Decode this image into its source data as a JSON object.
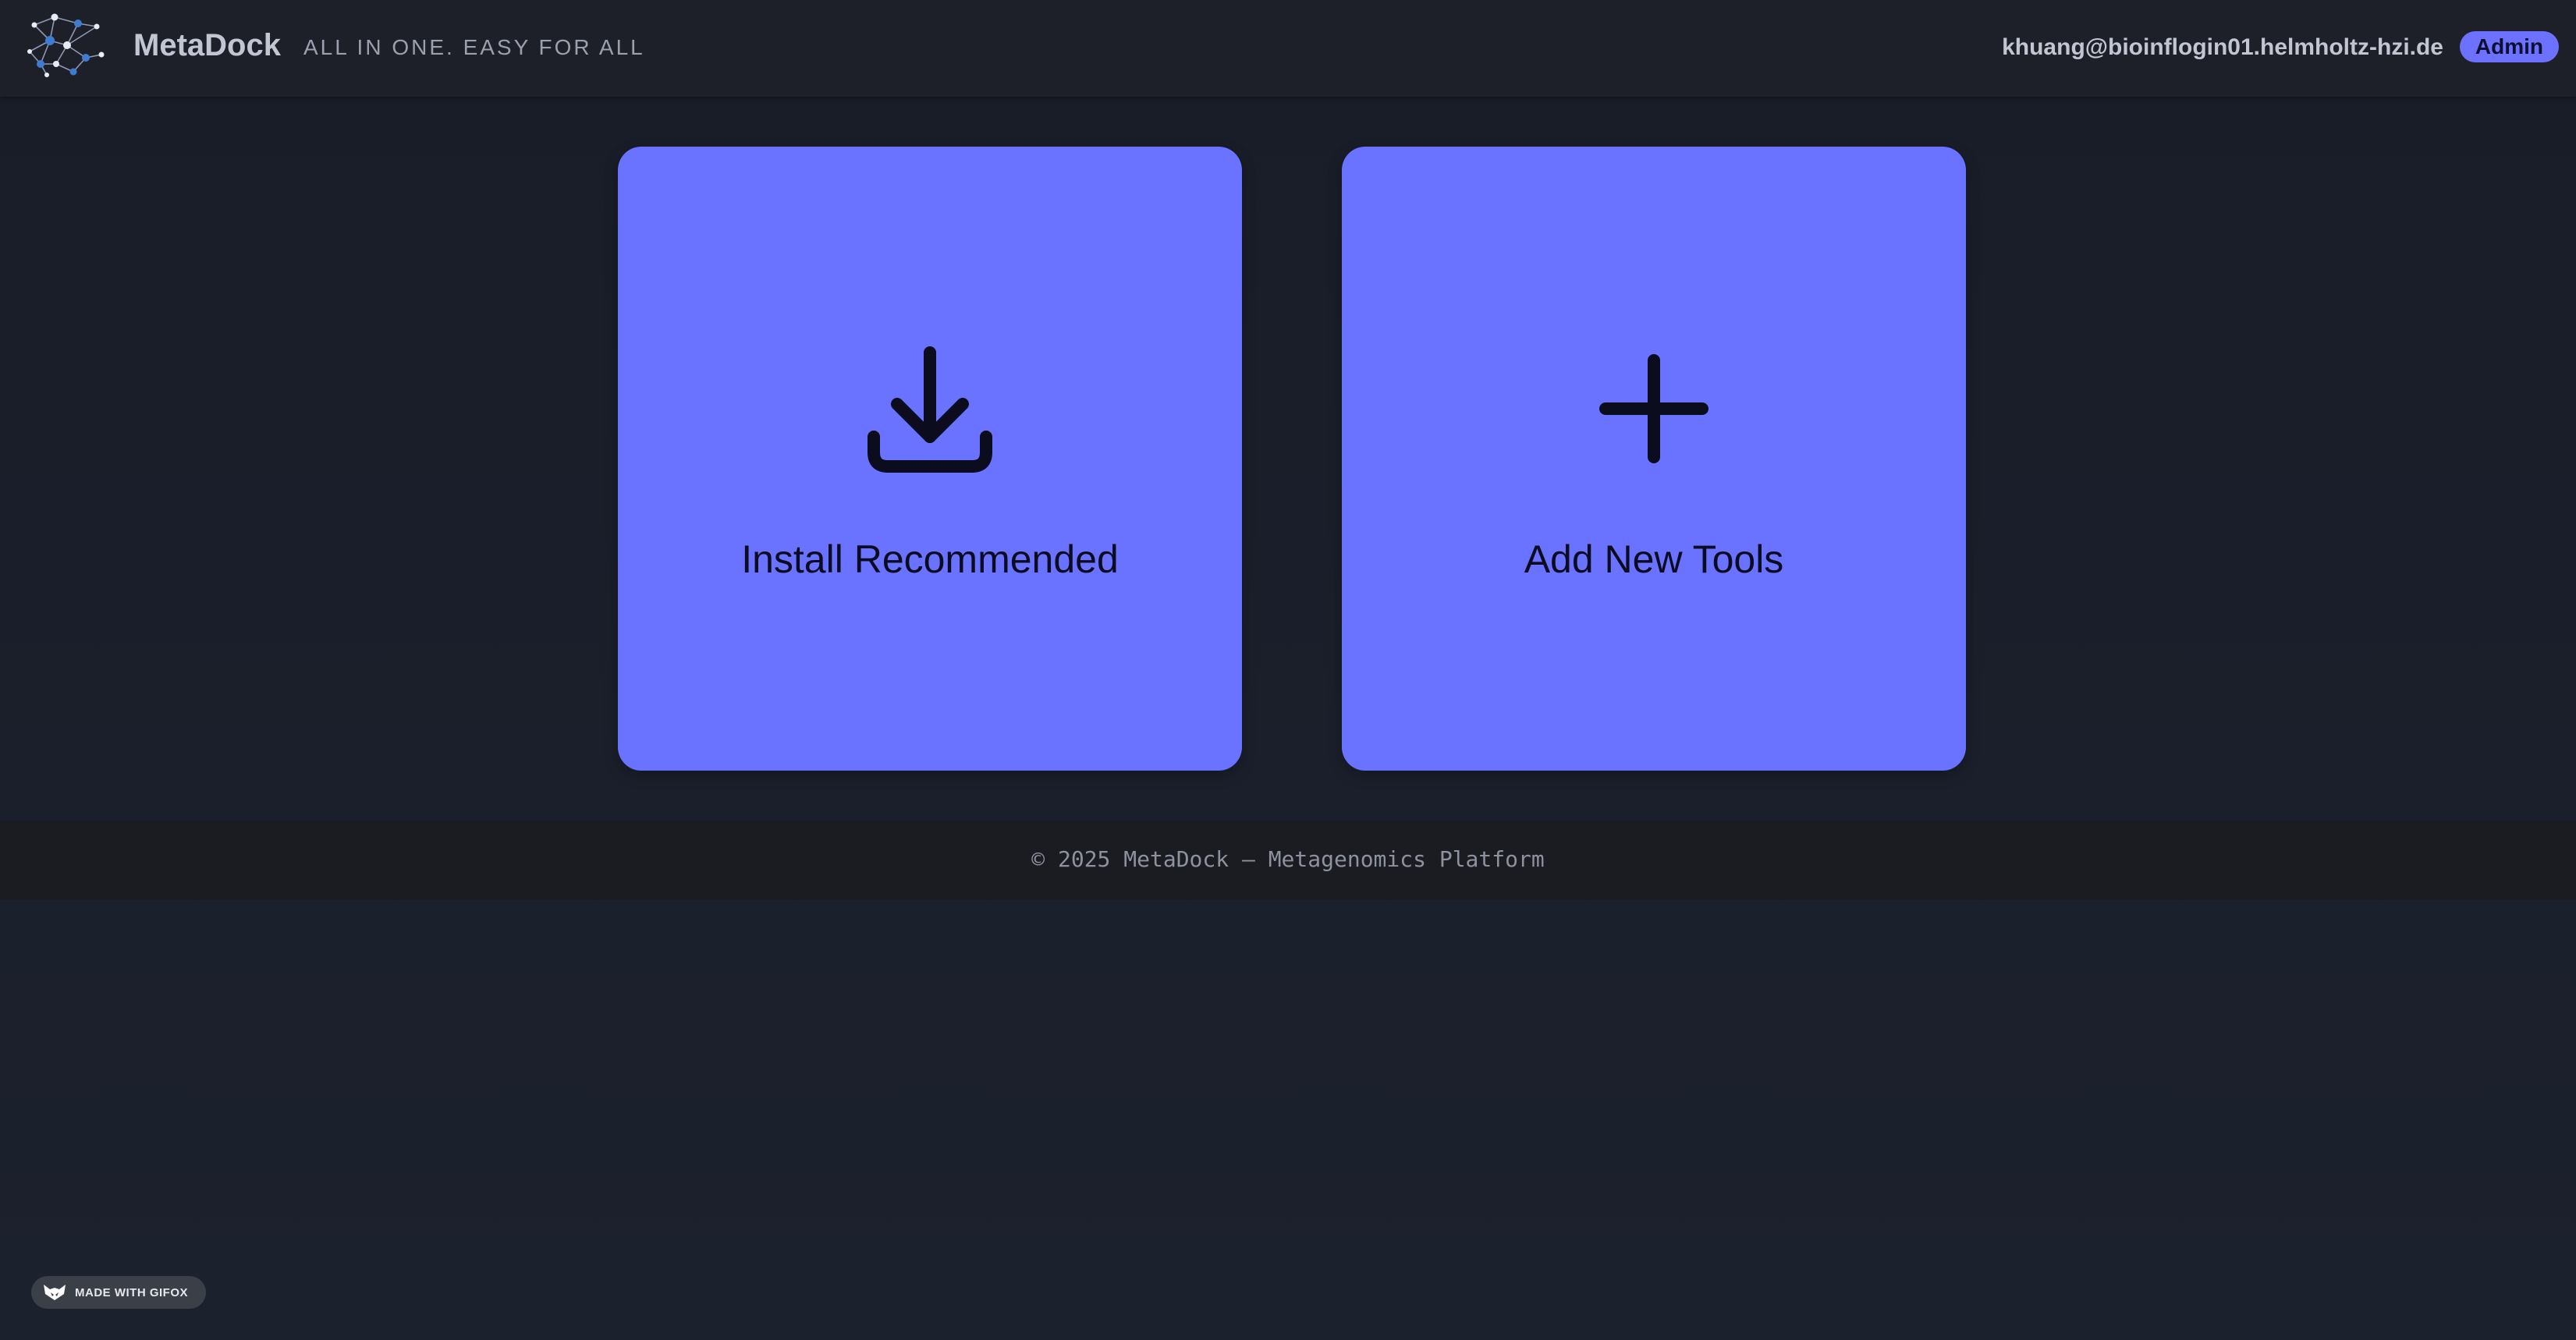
{
  "header": {
    "brand_name": "MetaDock",
    "tagline": "ALL IN ONE. EASY FOR ALL",
    "logo_icon": "network-graph-logo",
    "user_email": "khuang@bioinflogin01.helmholtz-hzi.de",
    "role_badge": "Admin"
  },
  "actions": [
    {
      "label": "Install Recommended",
      "icon": "download-icon"
    },
    {
      "label": "Add New Tools",
      "icon": "plus-icon"
    }
  ],
  "footer": {
    "text": "© 2025 MetaDock — Metagenomics Platform"
  },
  "watermark": {
    "text": "MADE WITH GIFOX",
    "icon": "gifox-fox-icon"
  },
  "colors": {
    "accent": "#6a73ff",
    "background": "#1a1e29",
    "header_bg": "#1d2029",
    "footer_bg": "#1a1c22"
  }
}
